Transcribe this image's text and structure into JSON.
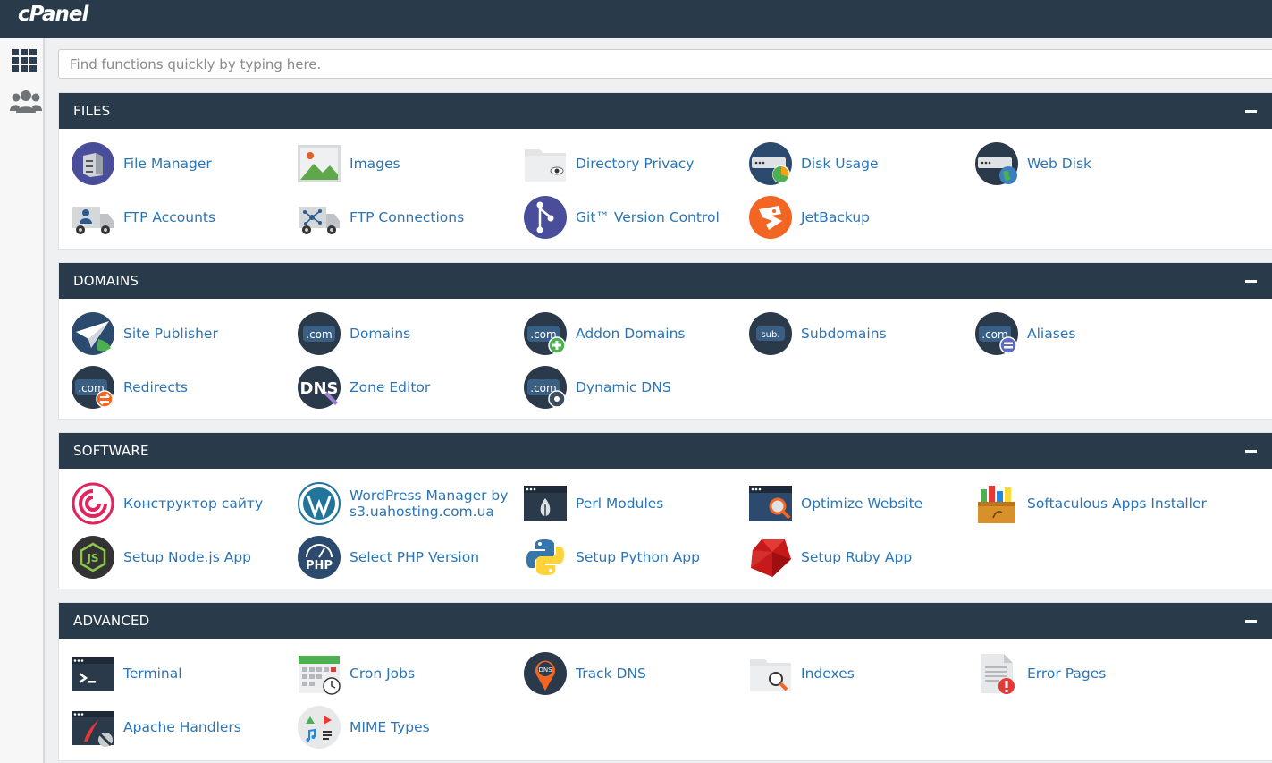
{
  "app": {
    "logo": "cPanel"
  },
  "search": {
    "placeholder": "Find functions quickly by typing here."
  },
  "sidebar": {
    "items": [
      {
        "icon": "grid-icon"
      },
      {
        "icon": "users-icon"
      }
    ]
  },
  "sections": [
    {
      "title": "FILES",
      "items": [
        {
          "label": "File Manager"
        },
        {
          "label": "Images"
        },
        {
          "label": "Directory Privacy"
        },
        {
          "label": "Disk Usage"
        },
        {
          "label": "Web Disk"
        },
        {
          "label": "FTP Accounts"
        },
        {
          "label": "FTP Connections"
        },
        {
          "label": "Git™ Version Control"
        },
        {
          "label": "JetBackup"
        }
      ]
    },
    {
      "title": "DOMAINS",
      "items": [
        {
          "label": "Site Publisher"
        },
        {
          "label": "Domains"
        },
        {
          "label": "Addon Domains"
        },
        {
          "label": "Subdomains"
        },
        {
          "label": "Aliases"
        },
        {
          "label": "Redirects"
        },
        {
          "label": "Zone Editor"
        },
        {
          "label": "Dynamic DNS"
        }
      ]
    },
    {
      "title": "SOFTWARE",
      "items": [
        {
          "label": "Конструктор сайту"
        },
        {
          "label": "WordPress Manager by s3.uahosting.com.ua"
        },
        {
          "label": "Perl Modules"
        },
        {
          "label": "Optimize Website"
        },
        {
          "label": "Softaculous Apps Installer"
        },
        {
          "label": "Setup Node.js App"
        },
        {
          "label": "Select PHP Version"
        },
        {
          "label": "Setup Python App"
        },
        {
          "label": "Setup Ruby App"
        }
      ]
    },
    {
      "title": "ADVANCED",
      "items": [
        {
          "label": "Terminal"
        },
        {
          "label": "Cron Jobs"
        },
        {
          "label": "Track DNS"
        },
        {
          "label": "Indexes"
        },
        {
          "label": "Error Pages"
        },
        {
          "label": "Apache Handlers"
        },
        {
          "label": "MIME Types"
        }
      ]
    }
  ],
  "icon_text": {
    "com": ".com",
    "sub": "sub.",
    "dns": "DNS",
    "php": "PHP",
    "js": "JS"
  },
  "colors": {
    "header": "#293a4a",
    "link": "#2a75b8",
    "background": "#eef0f2"
  }
}
